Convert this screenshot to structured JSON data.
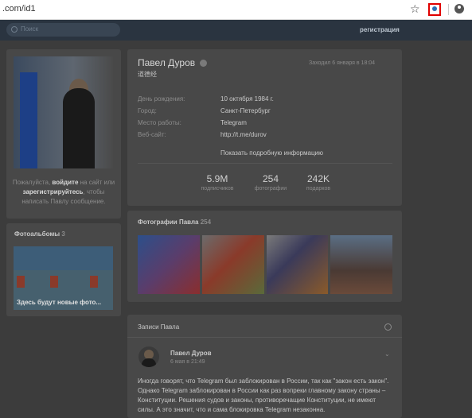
{
  "browser": {
    "url": ".com/id1"
  },
  "header": {
    "search_placeholder": "Поиск",
    "register_label": "регистрация"
  },
  "left": {
    "prompt_1": "Пожалуйста,",
    "prompt_login": "войдите",
    "prompt_2": "на сайт или",
    "prompt_register": "зарегистрируйтесь",
    "prompt_3": ", чтобы написать Павлу сообщение.",
    "albums_title": "Фотоальбомы",
    "albums_count": "3",
    "album_caption": "Здесь будут новые фото..."
  },
  "profile": {
    "name": "Павел Дуров",
    "status": "道德经",
    "last_seen": "Заходил 6 января в 18:04",
    "fields": [
      {
        "label": "День рождения:",
        "value": "10 октября 1984 г."
      },
      {
        "label": "Город:",
        "value": "Санкт-Петербург"
      },
      {
        "label": "Место работы:",
        "value": "Telegram"
      },
      {
        "label": "Веб-сайт:",
        "value": "http://t.me/durov"
      }
    ],
    "more_info": "Показать подробную информацию",
    "stats": [
      {
        "value": "5.9M",
        "label": "подписчиков"
      },
      {
        "value": "254",
        "label": "фотографии"
      },
      {
        "value": "242K",
        "label": "подарков"
      }
    ]
  },
  "photos": {
    "title": "Фотографии Павла",
    "count": "254"
  },
  "wall": {
    "title": "Записи Павла",
    "post_author": "Павел Дуров",
    "post_date": "6 мая в 21:49",
    "post_text": "Иногда говорят, что Telegram был заблокирован в России, так как \"закон есть закон\". Однако Telegram заблокирован в России как раз вопреки главному закону страны – Конституции. Решения судов и законы, противоречащие Конституции, не имеют силы. А это значит, что и сама блокировка Telegram незаконна."
  }
}
